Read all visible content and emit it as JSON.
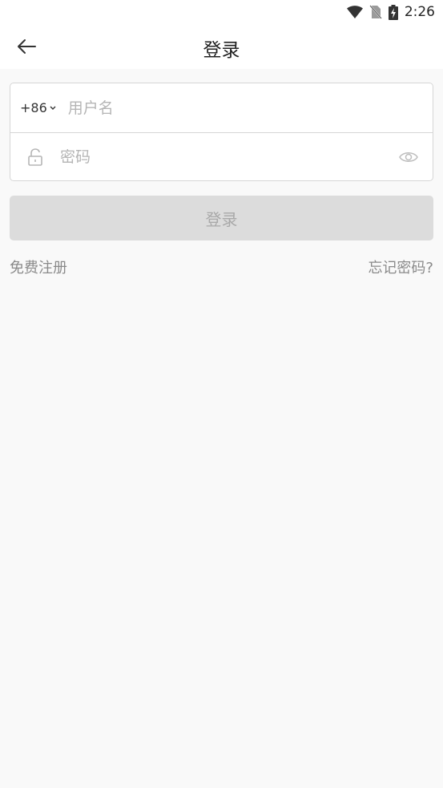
{
  "status_bar": {
    "time": "2:26",
    "icons": [
      "wifi-icon",
      "no-sim-icon",
      "battery-charging-icon"
    ]
  },
  "app_bar": {
    "title": "登录",
    "back_icon": "arrow-left-icon"
  },
  "form": {
    "country_code": "+86",
    "username_placeholder": "用户名",
    "username_value": "",
    "password_placeholder": "密码",
    "password_value": "",
    "lock_icon": "lock-icon",
    "eye_icon": "eye-icon"
  },
  "login_button": {
    "label": "登录"
  },
  "links": {
    "register": "免费注册",
    "forgot_password": "忘记密码?"
  },
  "colors": {
    "background": "#f9f9f9",
    "button_disabled": "#dcdcdc",
    "button_text_disabled": "#a9a9a9",
    "link": "#8a8a8a",
    "border": "#d6d6d6"
  }
}
